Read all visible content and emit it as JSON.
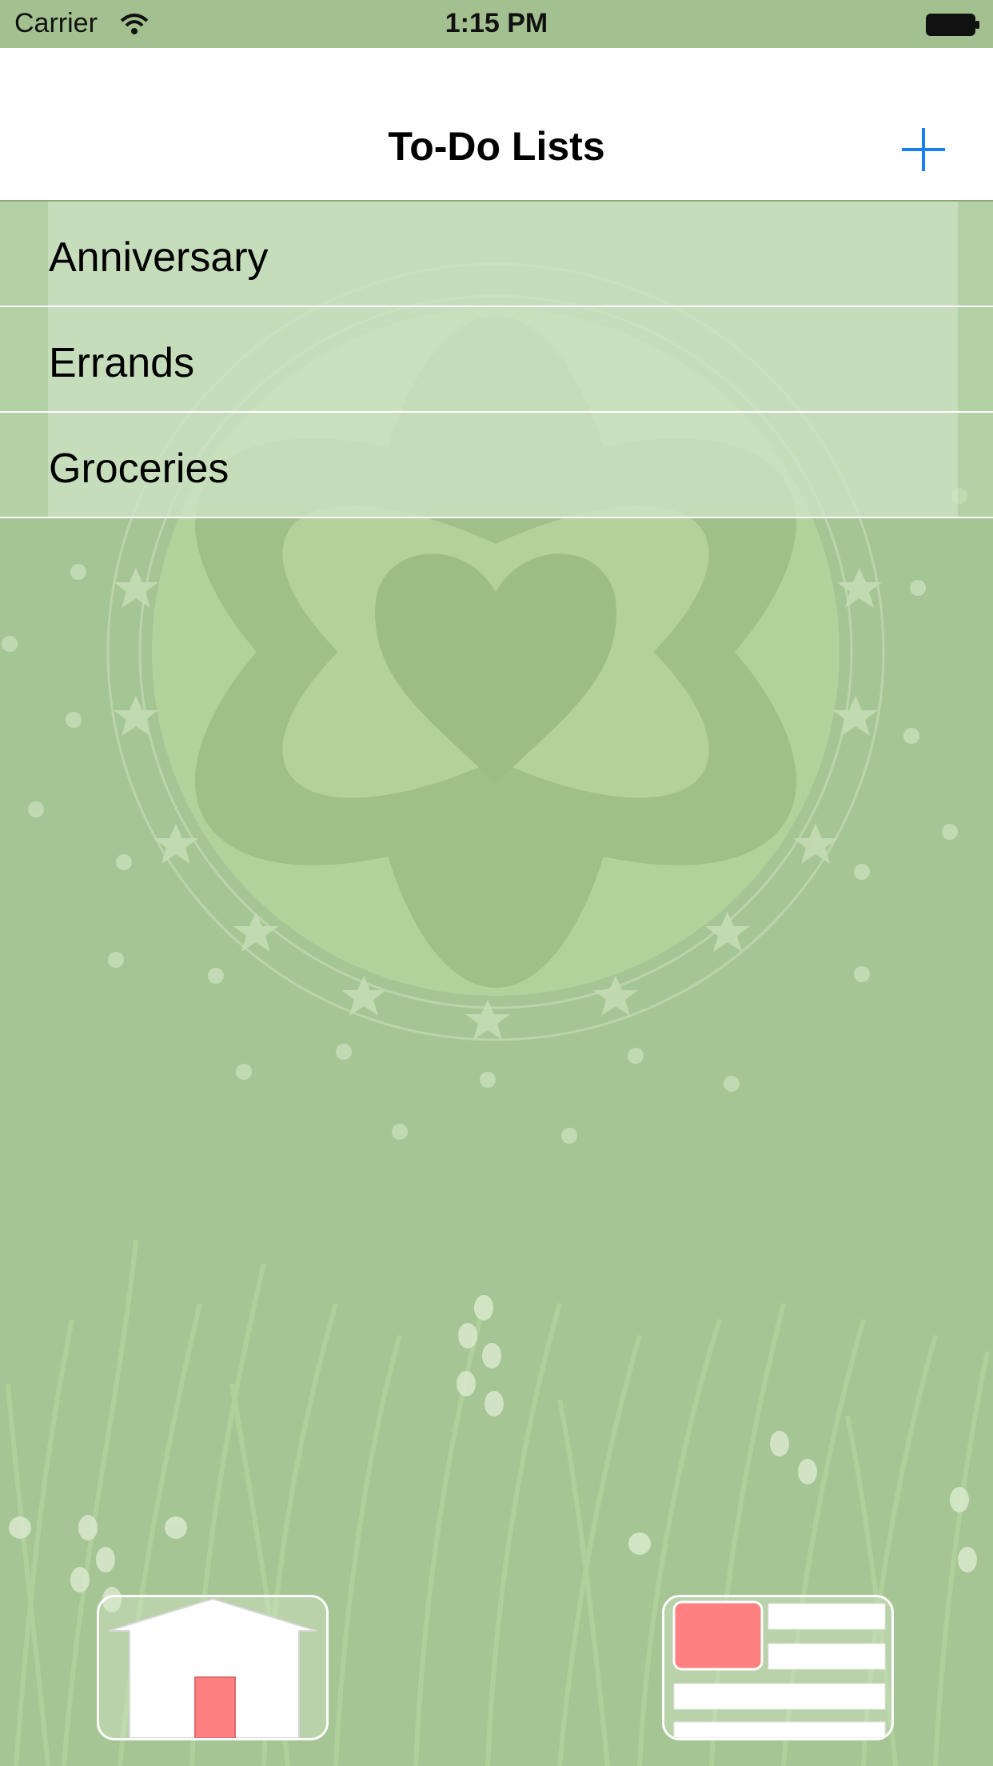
{
  "status_bar": {
    "carrier": "Carrier",
    "time": "1:15 PM"
  },
  "nav": {
    "title": "To-Do Lists",
    "add_icon": "plus-icon",
    "accent_color": "#1a7ef5"
  },
  "lists": [
    {
      "label": "Anniversary"
    },
    {
      "label": "Errands"
    },
    {
      "label": "Groceries"
    }
  ],
  "bottom_bar": {
    "home_icon": "home-icon",
    "list_icon": "list-view-icon",
    "accent_color": "#ff8080"
  },
  "colors": {
    "background": "#a6c594",
    "status_bar": "#a3c190"
  }
}
